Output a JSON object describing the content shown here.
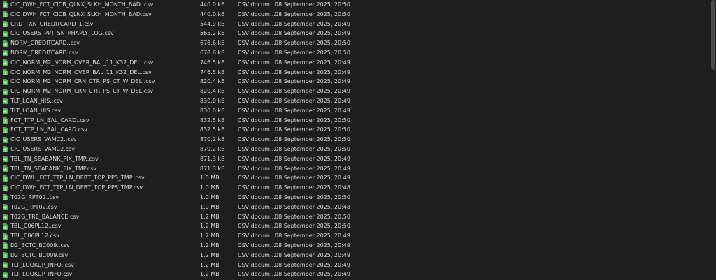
{
  "colors": {
    "background": "#1e1e1e",
    "text": "#d6d6d6",
    "icon": "#4caf50"
  },
  "file_icon": "spreadsheet-file-icon",
  "files": [
    {
      "name": "CIC_DWH_FCT_CICB_QLNX_SLKH_MONTH_BAD..csv",
      "size": "440.0 kB",
      "type": "CSV docum…",
      "modified": "08 September 2025, 20:50"
    },
    {
      "name": "CIC_DWH_FCT_CICB_QLNX_SLKH_MONTH_BAD.csv",
      "size": "440.0 kB",
      "type": "CSV docum…",
      "modified": "08 September 2025, 20:50"
    },
    {
      "name": "CRD_TXN_CREDITCARD_1.csv",
      "size": "544.9 kB",
      "type": "CSV docum…",
      "modified": "08 September 2025, 20:49"
    },
    {
      "name": "CIC_USERS_PPT_SN_PHAPLY_LOG.csv",
      "size": "565.2 kB",
      "type": "CSV docum…",
      "modified": "08 September 2025, 20:49"
    },
    {
      "name": "NORM_CREDITCARD..csv",
      "size": "678.6 kB",
      "type": "CSV docum…",
      "modified": "08 September 2025, 20:50"
    },
    {
      "name": "NORM_CREDITCARD.csv",
      "size": "678.6 kB",
      "type": "CSV docum…",
      "modified": "08 September 2025, 20:50"
    },
    {
      "name": "CIC_NORM_M2_NORM_OVER_BAL_11_K32_DEL..csv",
      "size": "746.5 kB",
      "type": "CSV docum…",
      "modified": "08 September 2025, 20:49"
    },
    {
      "name": "CIC_NORM_M2_NORM_OVER_BAL_11_K32_DEL.csv",
      "size": "746.5 kB",
      "type": "CSV docum…",
      "modified": "08 September 2025, 20:49"
    },
    {
      "name": "CIC_NORM_M2_NORM_CRN_CTR_PS_CT_W_DEL..csv",
      "size": "820.4 kB",
      "type": "CSV docum…",
      "modified": "08 September 2025, 20:49"
    },
    {
      "name": "CIC_NORM_M2_NORM_CRN_CTR_PS_CT_W_DEL.csv",
      "size": "820.4 kB",
      "type": "CSV docum…",
      "modified": "08 September 2025, 20:49"
    },
    {
      "name": "TLT_LOAN_HIS..csv",
      "size": "830.0 kB",
      "type": "CSV docum…",
      "modified": "08 September 2025, 20:49"
    },
    {
      "name": "TLT_LOAN_HIS.csv",
      "size": "830.0 kB",
      "type": "CSV docum…",
      "modified": "08 September 2025, 20:49"
    },
    {
      "name": "FCT_TTP_LN_BAL_CARD..csv",
      "size": "832.5 kB",
      "type": "CSV docum…",
      "modified": "08 September 2025, 20:50"
    },
    {
      "name": "FCT_TTP_LN_BAL_CARD.csv",
      "size": "832.5 kB",
      "type": "CSV docum…",
      "modified": "08 September 2025, 20:50"
    },
    {
      "name": "CIC_USERS_VAMC2..csv",
      "size": "870.2 kB",
      "type": "CSV docum…",
      "modified": "08 September 2025, 20:50"
    },
    {
      "name": "CIC_USERS_VAMC2.csv",
      "size": "870.2 kB",
      "type": "CSV docum…",
      "modified": "08 September 2025, 20:50"
    },
    {
      "name": "TBL_TN_SEABANK_FIX_TMP..csv",
      "size": "871.3 kB",
      "type": "CSV docum…",
      "modified": "08 September 2025, 20:49"
    },
    {
      "name": "TBL_TN_SEABANK_FIX_TMP.csv",
      "size": "871.3 kB",
      "type": "CSV docum…",
      "modified": "08 September 2025, 20:49"
    },
    {
      "name": "CIC_DWH_FCT_TTP_LN_DEBT_TOP_PPS_TMP..csv",
      "size": "1.0 MB",
      "type": "CSV docum…",
      "modified": "08 September 2025, 20:49"
    },
    {
      "name": "CIC_DWH_FCT_TTP_LN_DEBT_TOP_PPS_TMP.csv",
      "size": "1.0 MB",
      "type": "CSV docum…",
      "modified": "08 September 2025, 20:48"
    },
    {
      "name": "T02G_RPT02..csv",
      "size": "1.0 MB",
      "type": "CSV docum…",
      "modified": "08 September 2025, 20:50"
    },
    {
      "name": "T02G_RPT02.csv",
      "size": "1.0 MB",
      "type": "CSV docum…",
      "modified": "08 September 2025, 20:48"
    },
    {
      "name": "T02G_TRE_BALANCE.csv",
      "size": "1.2 MB",
      "type": "CSV docum…",
      "modified": "08 September 2025, 20:50"
    },
    {
      "name": "TBL_C06PL12..csv",
      "size": "1.2 MB",
      "type": "CSV docum…",
      "modified": "08 September 2025, 20:50"
    },
    {
      "name": "TBL_C06PL12.csv",
      "size": "1.2 MB",
      "type": "CSV docum…",
      "modified": "08 September 2025, 20:49"
    },
    {
      "name": "D2_BCTC_BC009..csv",
      "size": "1.2 MB",
      "type": "CSV docum…",
      "modified": "08 September 2025, 20:49"
    },
    {
      "name": "D2_BCTC_BC009.csv",
      "size": "1.2 MB",
      "type": "CSV docum…",
      "modified": "08 September 2025, 20:49"
    },
    {
      "name": "TLT_LOOKUP_INFO..csv",
      "size": "1.2 MB",
      "type": "CSV docum…",
      "modified": "08 September 2025, 20:49"
    },
    {
      "name": "TLT_LOOKUP_INFO.csv",
      "size": "1.2 MB",
      "type": "CSV docum…",
      "modified": "08 September 2025, 20:49"
    }
  ]
}
